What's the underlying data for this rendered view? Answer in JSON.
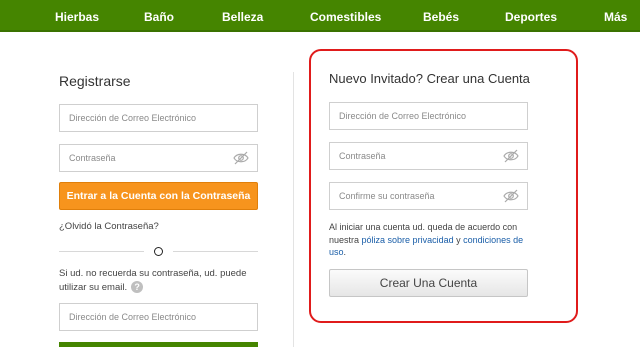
{
  "nav": {
    "items": [
      "Hierbas",
      "Baño",
      "Belleza",
      "Comestibles",
      "Bebés",
      "Deportes",
      "Más"
    ]
  },
  "login": {
    "title": "Registrarse",
    "email_placeholder": "Dirección de Correo Electrónico",
    "password_placeholder": "Contraseña",
    "login_button": "Entrar a la Cuenta con la Contraseña",
    "forgot_link": "¿Olvidó la Contraseña?",
    "divider_label": "O",
    "email_link_text": "Si ud. no recuerda su contraseña, ud. puede utilizar su email.",
    "help_icon": "?",
    "email2_placeholder": "Dirección de Correo Electrónico"
  },
  "guest": {
    "title": "Nuevo Invitado? Crear una Cuenta",
    "email_placeholder": "Dirección de Correo Electrónico",
    "password_placeholder": "Contraseña",
    "confirm_placeholder": "Confirme su contraseña",
    "terms_prefix": "Al iniciar una cuenta ud. queda de acuerdo con nuestra ",
    "privacy_link": "póliza sobre privacidad",
    "terms_and": " y ",
    "conditions_link": "condiciones de uso",
    "terms_suffix": ".",
    "create_button": "Crear Una Cuenta"
  },
  "colors": {
    "nav_green": "#458500",
    "login_orange": "#f7941d",
    "highlight_red": "#e01b1b",
    "link_blue": "#1a5ea8"
  },
  "icons": {
    "password_visibility": "eye-slash-icon",
    "help": "question-circle-icon"
  }
}
